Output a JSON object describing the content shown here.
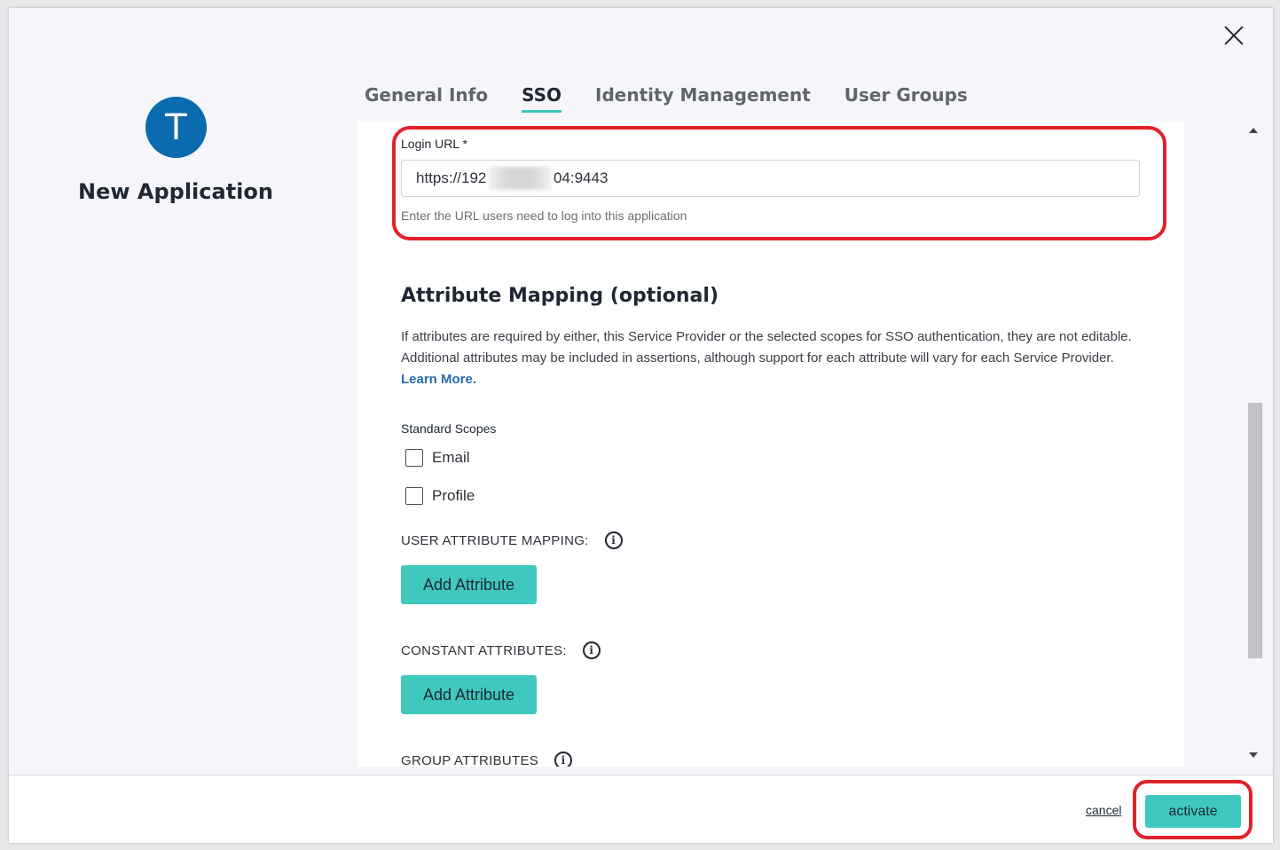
{
  "app": {
    "avatar_letter": "T",
    "name": "New Application"
  },
  "tabs": [
    {
      "label": "General Info",
      "active": false
    },
    {
      "label": "SSO",
      "active": true
    },
    {
      "label": "Identity Management",
      "active": false
    },
    {
      "label": "User Groups",
      "active": false
    }
  ],
  "login_url": {
    "label": "Login URL *",
    "value": "https://192                04:9443",
    "help": "Enter the URL users need to log into this application"
  },
  "attribute_mapping": {
    "title": "Attribute Mapping (optional)",
    "description": "If attributes are required by either, this Service Provider or the selected scopes for SSO authentication, they are not editable. Additional attributes may be included in assertions, although support for each attribute will vary for each Service Provider. ",
    "learn_more": "Learn More."
  },
  "scopes": {
    "label": "Standard Scopes",
    "items": [
      {
        "label": "Email",
        "checked": false
      },
      {
        "label": "Profile",
        "checked": false
      }
    ]
  },
  "user_attribute_mapping": {
    "label": "USER ATTRIBUTE MAPPING:",
    "button": "Add Attribute"
  },
  "constant_attributes": {
    "label": "CONSTANT ATTRIBUTES:",
    "button": "Add Attribute"
  },
  "group_attributes": {
    "label": "GROUP ATTRIBUTES"
  },
  "info_glyph": "i",
  "footer": {
    "cancel": "cancel",
    "activate": "activate"
  },
  "colors": {
    "accent": "#3ec8be",
    "avatar": "#0a6cae",
    "highlight": "#e3202a",
    "link": "#2a6cb0"
  }
}
